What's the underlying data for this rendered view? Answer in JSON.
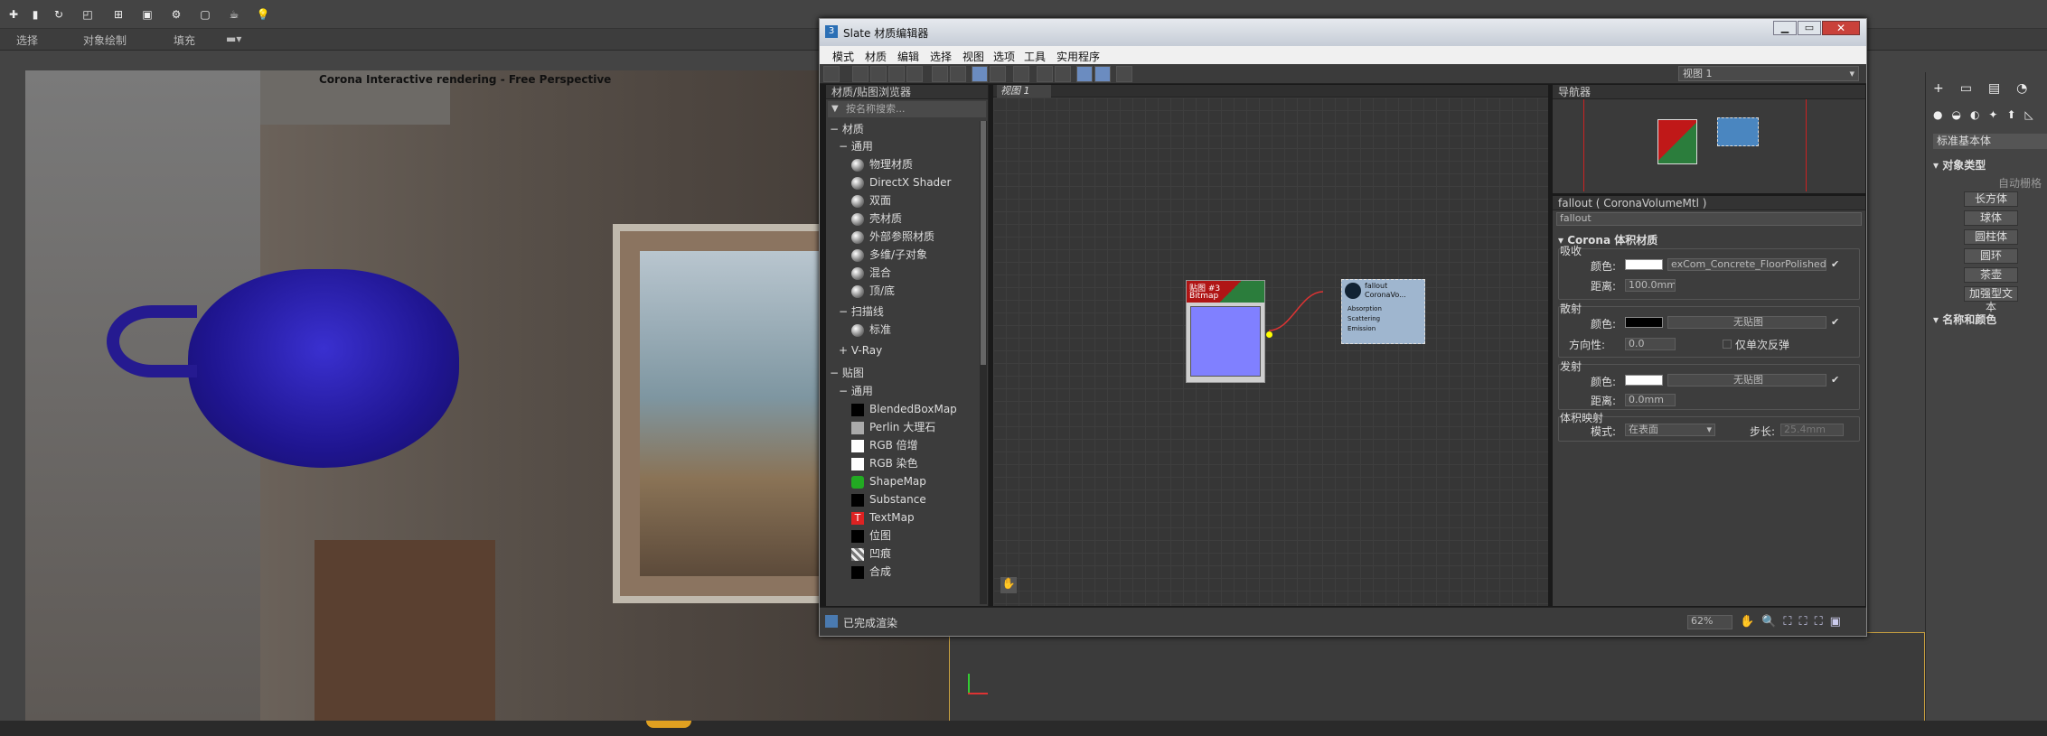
{
  "top_menu": {
    "select": "选择",
    "object_paint": "对象绘制",
    "fill": "填充"
  },
  "viewport": {
    "label": "Corona Interactive rendering - Free Perspective"
  },
  "slate": {
    "title": "Slate 材质编辑器",
    "menu": [
      "模式",
      "材质",
      "编辑",
      "选择",
      "视图",
      "选项",
      "工具",
      "实用程序"
    ],
    "view_dropdown": "视图 1",
    "browser": {
      "title": "材质/贴图浏览器",
      "search_placeholder": "按名称搜索...",
      "section_materials": "材质",
      "group_general": "通用",
      "materials": [
        "物理材质",
        "DirectX Shader",
        "双面",
        "壳材质",
        "外部参照材质",
        "多维/子对象",
        "混合",
        "顶/底"
      ],
      "group_scanline": "扫描线",
      "scanline_items": [
        "标准"
      ],
      "group_vray": "V-Ray",
      "section_maps": "贴图",
      "group_maps_general": "通用",
      "maps": [
        "BlendedBoxMap",
        "Perlin 大理石",
        "RGB 倍增",
        "RGB 染色",
        "ShapeMap",
        "Substance",
        "TextMap",
        "位图",
        "凹痕",
        "合成"
      ]
    },
    "view_tab": "视图 1",
    "nodes": {
      "bitmap_title": "贴图 #3",
      "bitmap_type": "Bitmap",
      "fallout_title": "fallout",
      "fallout_type": "CoronaVo...",
      "fallout_slots": [
        "Absorption",
        "Scattering",
        "Emission"
      ]
    },
    "navigator_title": "导航器",
    "params": {
      "header": "fallout ( CoronaVolumeMtl )",
      "name_field": "fallout",
      "rollout_title": "Corona 体积材质",
      "absorption": {
        "title": "吸收",
        "color_label": "颜色:",
        "color": "#ffffff",
        "map": "exCom_Concrete_FloorPolished",
        "distance_label": "距离:",
        "distance": "100.0mm"
      },
      "scattering": {
        "title": "散射",
        "color_label": "颜色:",
        "color": "#000000",
        "map": "无贴图",
        "dir_label": "方向性:",
        "dir": "0.0",
        "single_bounce": "仅单次反弹"
      },
      "emission": {
        "title": "发射",
        "color_label": "颜色:",
        "color": "#ffffff",
        "map": "无贴图",
        "distance_label": "距离:",
        "distance": "0.0mm"
      },
      "volume": {
        "title": "体积映射",
        "mode_label": "模式:",
        "mode": "在表面",
        "step_label": "步长:",
        "step": "25.4mm"
      }
    },
    "status_text": "已完成渲染",
    "zoom": "62%"
  },
  "right_panel": {
    "dropdown": "标准基本体",
    "object_type": "对象类型",
    "autogrid": "自动栅格",
    "buttons": [
      "长方体",
      "球体",
      "圆柱体",
      "圆环",
      "茶壶",
      "加强型文本"
    ],
    "name_color": "名称和颜色"
  }
}
